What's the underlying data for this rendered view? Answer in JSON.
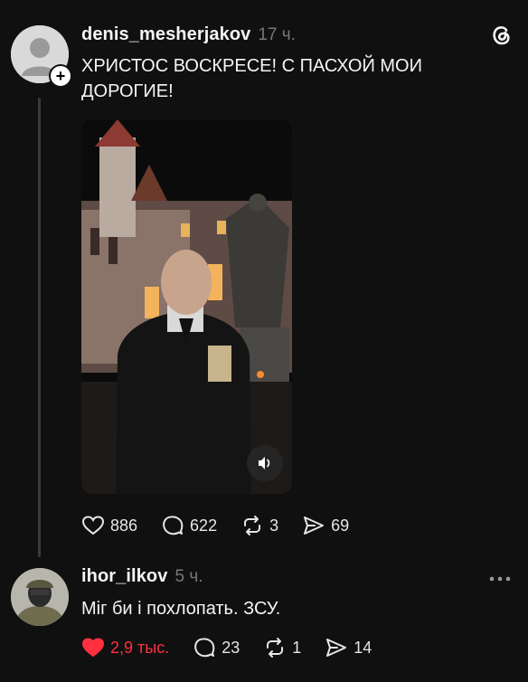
{
  "post": {
    "username": "denis_mesherjakov",
    "time": "17 ч.",
    "text_line1": "ХРИСТОС ВОСКРЕСЕ! С ПАСХОЙ МОИ",
    "text_line2": "ДОРОГИЕ!",
    "likes": "886",
    "comments": "622",
    "reposts": "3",
    "shares": "69"
  },
  "reply": {
    "username": "ihor_ilkov",
    "time": "5 ч.",
    "text": "Міг би і похлопать. ЗСУ.",
    "likes": "2,9 тыс.",
    "comments": "23",
    "reposts": "1",
    "shares": "14"
  },
  "colors": {
    "background": "#101010",
    "liked": "#ff3040",
    "muted": "#777777"
  },
  "icons": [
    "threads-logo-icon",
    "heart-icon",
    "comment-icon",
    "repost-icon",
    "share-icon",
    "more-icon",
    "sound-icon"
  ]
}
